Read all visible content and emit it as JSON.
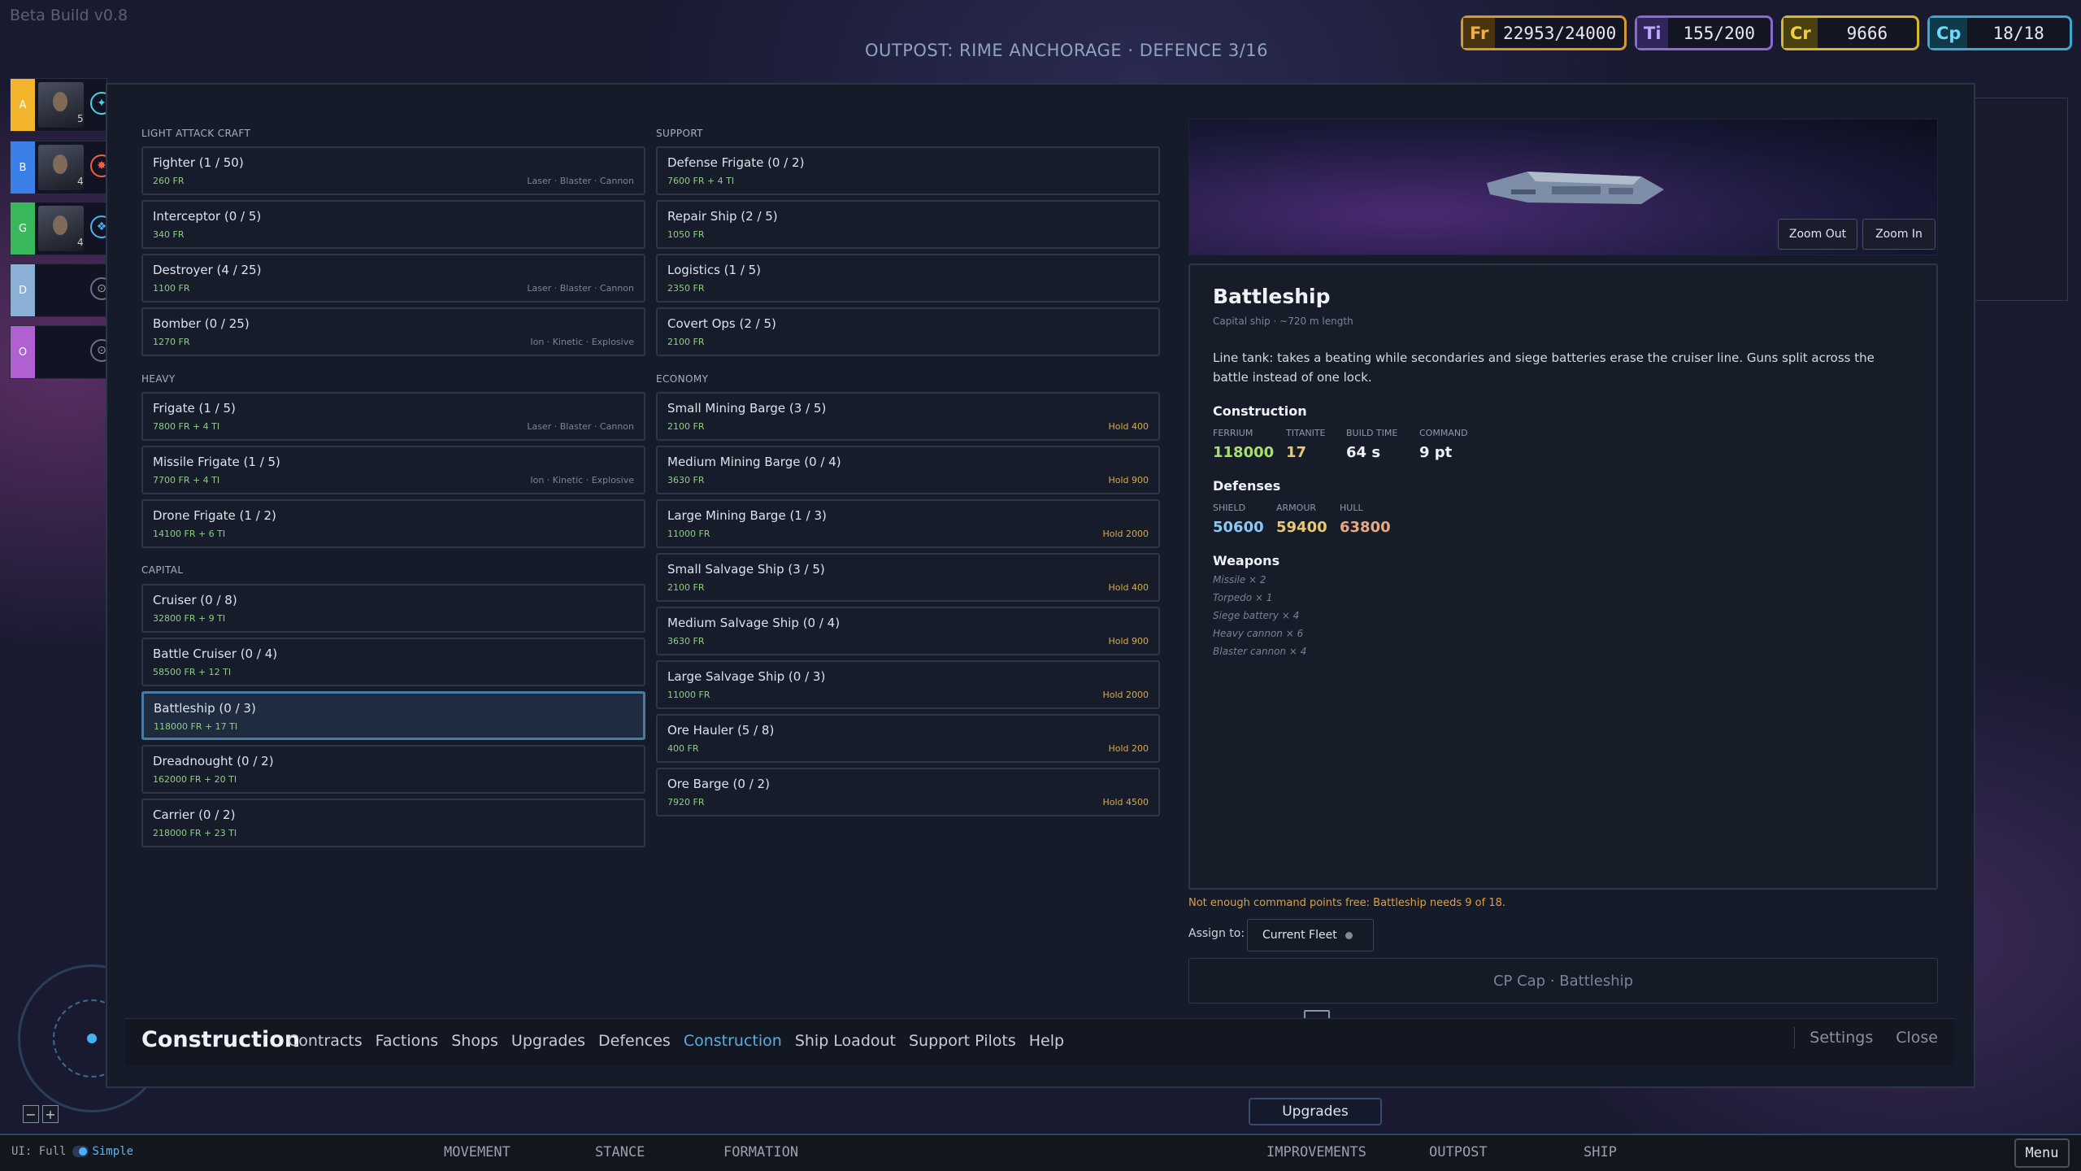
{
  "build": "Beta Build v0.8",
  "outpost_title": "OUTPOST: RIME ANCHORAGE · DEFENCE 3/16",
  "resources": [
    {
      "tag": "Fr",
      "value": "22953/24000",
      "color": "#d49a2e"
    },
    {
      "tag": "Ti",
      "value": "155/200",
      "color": "#8a6ad0"
    },
    {
      "tag": "Cr",
      "value": "9666",
      "color": "#d4b82e"
    },
    {
      "tag": "Cp",
      "value": "18/18",
      "color": "#3aa8d0"
    }
  ],
  "fleets": [
    {
      "letter": "A",
      "count": "5",
      "color": "#f2b52c"
    },
    {
      "letter": "B",
      "count": "4",
      "color": "#3a80e8"
    },
    {
      "letter": "G",
      "count": "4",
      "color": "#38b85a"
    },
    {
      "letter": "D",
      "count": "",
      "color": "#8ab0d8"
    },
    {
      "letter": "O",
      "count": "",
      "color": "#b060d0"
    }
  ],
  "sections": {
    "light": "LIGHT ATTACK CRAFT",
    "heavy": "HEAVY",
    "capital": "CAPITAL",
    "support": "SUPPORT",
    "economy": "ECONOMY"
  },
  "light_ships": [
    {
      "name": "Fighter  (1 / 50)",
      "cost": "260 FR",
      "weapons": "Laser · Blaster · Cannon"
    },
    {
      "name": "Interceptor  (0 / 5)",
      "cost": "340 FR",
      "weapons": ""
    },
    {
      "name": "Destroyer  (4 / 25)",
      "cost": "1100 FR",
      "weapons": "Laser · Blaster · Cannon"
    },
    {
      "name": "Bomber  (0 / 25)",
      "cost": "1270 FR",
      "weapons": "Ion · Kinetic · Explosive"
    }
  ],
  "heavy_ships": [
    {
      "name": "Frigate  (1 / 5)",
      "cost": "7800 FR + 4 TI",
      "weapons": "Laser · Blaster · Cannon"
    },
    {
      "name": "Missile Frigate  (1 / 5)",
      "cost": "7700 FR + 4 TI",
      "weapons": "Ion · Kinetic · Explosive"
    },
    {
      "name": "Drone Frigate  (1 / 2)",
      "cost": "14100 FR + 6 TI",
      "weapons": ""
    }
  ],
  "capital_ships": [
    {
      "name": "Cruiser  (0 / 8)",
      "cost": "32800 FR + 9 TI"
    },
    {
      "name": "Battle Cruiser  (0 / 4)",
      "cost": "58500 FR + 12 TI"
    },
    {
      "name": "Battleship  (0 / 3)",
      "cost": "118000 FR + 17 TI"
    },
    {
      "name": "Dreadnought  (0 / 2)",
      "cost": "162000 FR + 20 TI"
    },
    {
      "name": "Carrier  (0 / 2)",
      "cost": "218000 FR + 23 TI"
    }
  ],
  "support_ships": [
    {
      "name": "Defense Frigate  (0 / 2)",
      "cost": "7600 FR + 4 TI"
    },
    {
      "name": "Repair Ship  (2 / 5)",
      "cost": "1050 FR"
    },
    {
      "name": "Logistics  (1 / 5)",
      "cost": "2350 FR"
    },
    {
      "name": "Covert Ops  (2 / 5)",
      "cost": "2100 FR"
    }
  ],
  "economy_ships": [
    {
      "name": "Small Mining Barge  (3 / 5)",
      "cost": "2100 FR",
      "hold": "Hold 400"
    },
    {
      "name": "Medium Mining Barge  (0 / 4)",
      "cost": "3630 FR",
      "hold": "Hold 900"
    },
    {
      "name": "Large Mining Barge  (1 / 3)",
      "cost": "11000 FR",
      "hold": "Hold 2000"
    },
    {
      "name": "Small Salvage Ship  (3 / 5)",
      "cost": "2100 FR",
      "hold": "Hold 400"
    },
    {
      "name": "Medium Salvage Ship  (0 / 4)",
      "cost": "3630 FR",
      "hold": "Hold 900"
    },
    {
      "name": "Large Salvage Ship  (0 / 3)",
      "cost": "11000 FR",
      "hold": "Hold 2000"
    },
    {
      "name": "Ore Hauler  (5 / 8)",
      "cost": "400 FR",
      "hold": "Hold 200"
    },
    {
      "name": "Ore Barge  (0 / 2)",
      "cost": "7920 FR",
      "hold": "Hold 4500"
    }
  ],
  "preview": {
    "zoom_out": "Zoom Out",
    "zoom_in": "Zoom In"
  },
  "detail": {
    "title": "Battleship",
    "subtitle": "Capital ship · ~720 m length",
    "description": "Line tank: takes a beating while secondaries and siege batteries erase the cruiser line. Guns split across the battle instead of one lock.",
    "construction_h": "Construction",
    "construction": [
      {
        "label": "FERRIUM",
        "value": "118000",
        "color": "#a8e070"
      },
      {
        "label": "TITANITE",
        "value": "17",
        "color": "#e8c870"
      },
      {
        "label": "BUILD TIME",
        "value": "64 s",
        "color": "#eef2f6"
      },
      {
        "label": "COMMAND",
        "value": "9 pt",
        "color": "#eef2f6"
      }
    ],
    "defenses_h": "Defenses",
    "defenses": [
      {
        "label": "SHIELD",
        "value": "50600",
        "color": "#8ac8f8"
      },
      {
        "label": "ARMOUR",
        "value": "59400",
        "color": "#e8c870"
      },
      {
        "label": "HULL",
        "value": "63800",
        "color": "#e8a880"
      }
    ],
    "weapons_h": "Weapons",
    "weapons": [
      "Missile × 2",
      "Torpedo × 1",
      "Siege battery × 4",
      "Heavy cannon × 6",
      "Blaster cannon × 4"
    ]
  },
  "warning": "Not enough command points free: Battleship needs 9 of 18.",
  "assign_label": "Assign to:",
  "assign_value": "Current Fleet",
  "cp_cap": "CP Cap · Battleship",
  "nav": {
    "title": "Construction",
    "tabs": [
      "Contracts",
      "Factions",
      "Shops",
      "Upgrades",
      "Defences",
      "Construction",
      "Ship Loadout",
      "Support Pilots",
      "Help"
    ],
    "active": "Construction",
    "settings": "Settings",
    "close": "Close"
  },
  "upgrades_btn": "Upgrades",
  "bottom": {
    "ui_label": "UI:",
    "ui_full": "Full",
    "ui_simple": "Simple",
    "items": [
      "MOVEMENT",
      "STANCE",
      "FORMATION",
      "IMPROVEMENTS",
      "OUTPOST",
      "SHIP"
    ],
    "menu": "Menu"
  },
  "zoom_controls": {
    "minus": "−",
    "plus": "+"
  }
}
